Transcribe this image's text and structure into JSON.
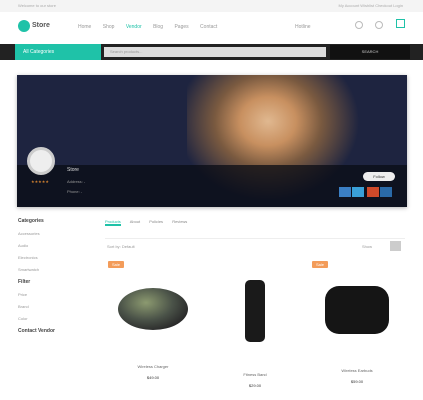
{
  "topbar": {
    "left": "Welcome to our store",
    "right": "My Account  Wishlist  Checkout  Login"
  },
  "header": {
    "logo": "Store",
    "nav": [
      "Home",
      "Shop",
      "Vendor",
      "Blog",
      "Pages",
      "Contact"
    ],
    "active_nav": 2,
    "hotline": "Hotline"
  },
  "bar": {
    "category": "All Categories",
    "search_placeholder": "Search products...",
    "search_button": "SEARCH"
  },
  "store": {
    "name": "Store",
    "address": "Address: -",
    "phone": "Phone: -",
    "follow": "Follow",
    "rating": "★★★★★"
  },
  "sidebar": {
    "sections": [
      {
        "title": "Categories",
        "items": [
          "Accessories",
          "Audio",
          "Electronics",
          "Smartwatch"
        ]
      },
      {
        "title": "Filter",
        "items": [
          "Price",
          "Brand",
          "Color"
        ]
      },
      {
        "title": "Contact Vendor",
        "items": []
      }
    ]
  },
  "tabs": [
    "Products",
    "About",
    "Policies",
    "Reviews"
  ],
  "sortbar": {
    "label": "Sort by: Default",
    "view": "Show"
  },
  "products": [
    {
      "name": "Wireless Charger",
      "price": "$49.00",
      "badge": "Sale"
    },
    {
      "name": "Fitness Band",
      "price": "$29.00",
      "badge": ""
    },
    {
      "name": "Wireless Earbuds",
      "price": "$59.00",
      "badge": "Sale"
    }
  ],
  "colors": {
    "accent": "#1fc2a8",
    "badge": "#f39c5a"
  }
}
